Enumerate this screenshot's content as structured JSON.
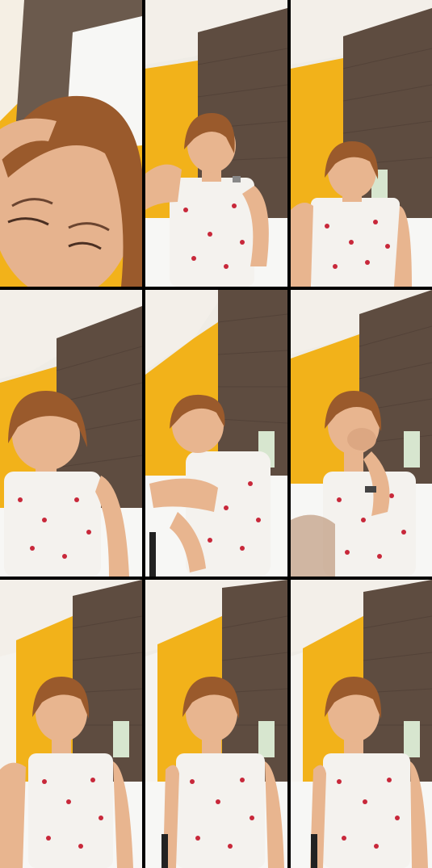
{
  "collage": {
    "rows": 3,
    "columns": 3,
    "colors": {
      "separator": "#000000",
      "wall_yellow": "#f2b21a",
      "wall_wood": "#5e4c40",
      "ceiling": "#f1ede6",
      "skin": "#e8b58f",
      "hair": "#9a5a2c",
      "dress": "#f4f2ee",
      "dress_print": "#c8283a",
      "pillow": "#f7f7f5"
    },
    "frames": [
      {
        "id": 1,
        "view": "face-close-up"
      },
      {
        "id": 2,
        "view": "hand-raised"
      },
      {
        "id": 3,
        "view": "seated-centered"
      },
      {
        "id": 4,
        "view": "leaning-forward"
      },
      {
        "id": 5,
        "view": "reclining"
      },
      {
        "id": 6,
        "view": "hand-to-mouth"
      },
      {
        "id": 7,
        "view": "seated-centered"
      },
      {
        "id": 8,
        "view": "seated-centered"
      },
      {
        "id": 9,
        "view": "seated-centered"
      }
    ]
  }
}
